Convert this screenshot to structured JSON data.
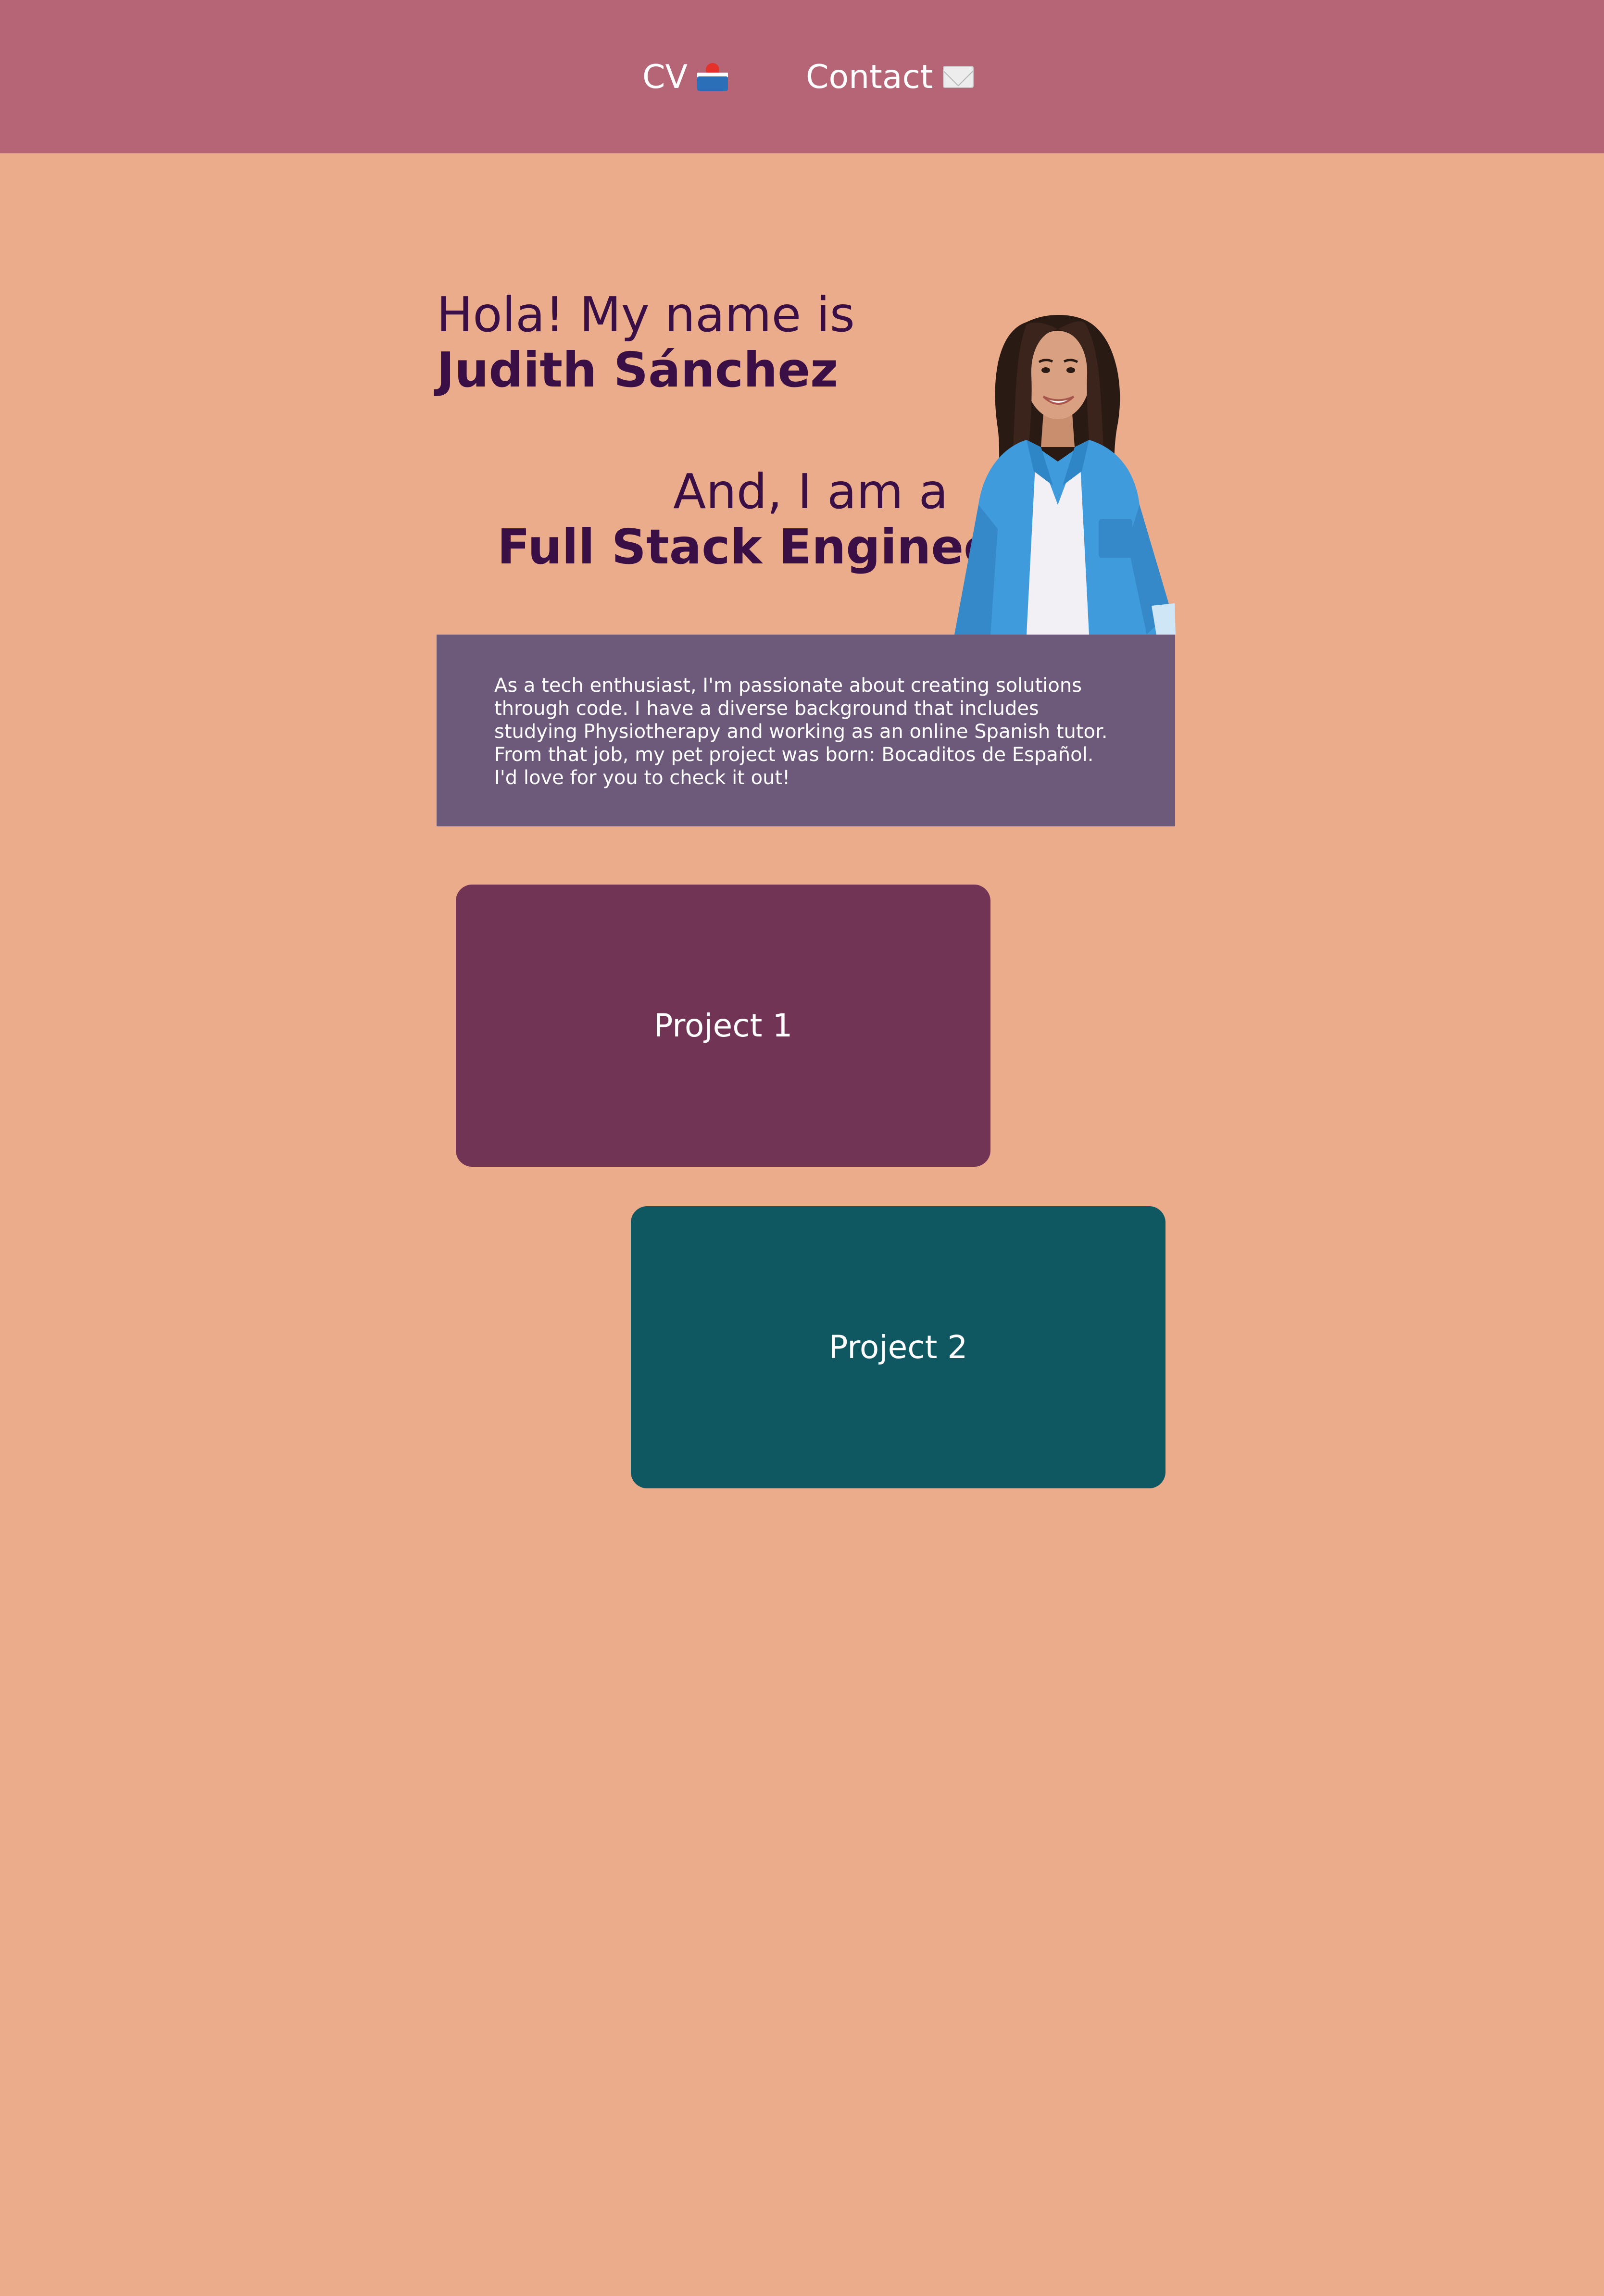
{
  "nav": {
    "items": [
      {
        "label": "CV",
        "icon": "inbox-tray-icon"
      },
      {
        "label": "Contact",
        "icon": "envelope-icon"
      }
    ]
  },
  "hero": {
    "greeting": "Hola! My name is",
    "name": "Judith Sánchez",
    "role_intro": "And, I am a",
    "role": "Full Stack Engineer"
  },
  "portrait": {
    "alt": "Portrait of Judith Sánchez"
  },
  "about": {
    "text": "As a tech enthusiast, I'm passionate about creating solutions through code. I have a diverse background that includes studying Physiotherapy and working as an online Spanish tutor. From that job, my pet project was born: Bocaditos de Español. I'd love for you to check it out!"
  },
  "projects": [
    {
      "label": "Project 1",
      "color": "#723455"
    },
    {
      "label": "Project 2",
      "color": "#0F5761"
    }
  ],
  "colors": {
    "background": "#EAAC8B",
    "nav": "#B56576",
    "heading_text": "#3A0F46",
    "about_box": "#6D597A"
  }
}
